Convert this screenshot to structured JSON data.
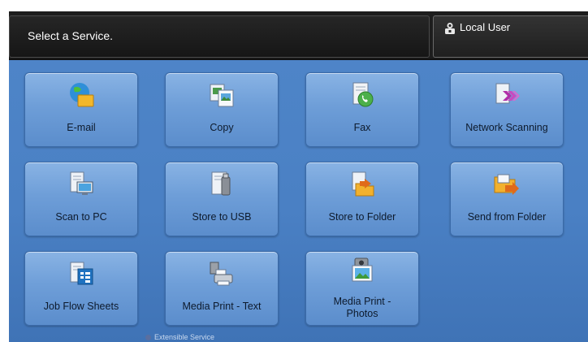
{
  "header": {
    "prompt": "Select a Service.",
    "user_label": "Local User"
  },
  "services": [
    {
      "label": "E-mail",
      "icon": "email-globe-icon"
    },
    {
      "label": "Copy",
      "icon": "copy-icon"
    },
    {
      "label": "Fax",
      "icon": "fax-phone-icon"
    },
    {
      "label": "Network Scanning",
      "icon": "network-scanning-icon"
    },
    {
      "label": "Scan to PC",
      "icon": "scan-to-pc-icon"
    },
    {
      "label": "Store to USB",
      "icon": "store-to-usb-icon"
    },
    {
      "label": "Store to Folder",
      "icon": "store-to-folder-icon"
    },
    {
      "label": "Send from Folder",
      "icon": "send-from-folder-icon"
    },
    {
      "label": "Job Flow Sheets",
      "icon": "job-flow-sheets-icon"
    },
    {
      "label": "Media Print - Text",
      "icon": "media-print-text-icon"
    },
    {
      "label": "Media Print -\nPhotos",
      "icon": "media-print-photos-icon"
    }
  ],
  "footer": {
    "extensible_label": "Extensible Service"
  },
  "colors": {
    "background": "#4a80c4",
    "tile_top": "#89b3e4",
    "tile_bottom": "#5b8dcc",
    "header": "#1d1d1d"
  }
}
